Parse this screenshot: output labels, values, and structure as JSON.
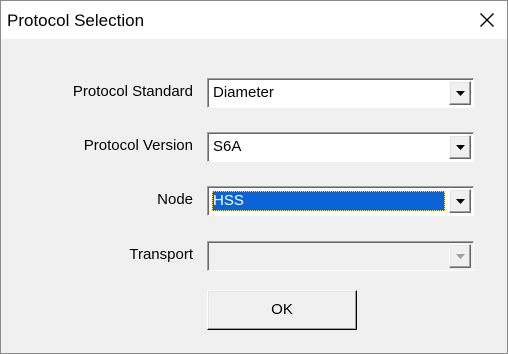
{
  "window": {
    "title": "Protocol Selection",
    "close_icon": "close-icon"
  },
  "form": {
    "protocol_standard": {
      "label": "Protocol Standard",
      "value": "Diameter"
    },
    "protocol_version": {
      "label": "Protocol Version",
      "value": "S6A"
    },
    "node": {
      "label": "Node",
      "value": "HSS",
      "selected": true
    },
    "transport": {
      "label": "Transport",
      "value": "",
      "disabled": true
    }
  },
  "buttons": {
    "ok_label": "OK"
  },
  "colors": {
    "selection_bg": "#0a64d8",
    "selection_text": "#ffffff",
    "dialog_bg": "#f0f0f0"
  }
}
